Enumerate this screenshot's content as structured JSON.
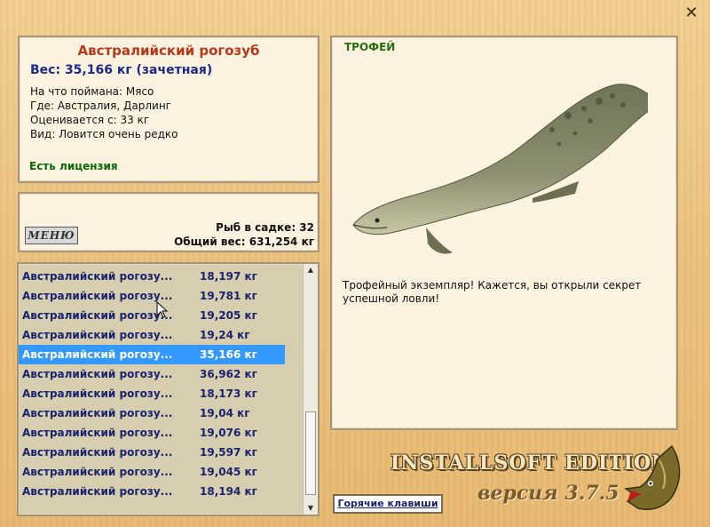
{
  "close_symbol": "✕",
  "info": {
    "title": "Австралийский рогозуб",
    "weight": "Вес: 35,166 кг (зачетная)",
    "caught_on": "На что поймана: Мясо",
    "location": "Где: Австралия, Дарлинг",
    "valued_from": "Оценивается с: 33 кг",
    "rarity": "Вид: Ловится очень редко",
    "license": "Есть лицензия"
  },
  "stats": {
    "menu_logo": "МЕНЮ",
    "fish_in_keepnet": "Рыб в садке: 32",
    "total_weight": "Общий вес: 631,254 кг"
  },
  "catch_list": {
    "rows": [
      {
        "name": "Австралийский рогозу...",
        "weight": "18,197 кг"
      },
      {
        "name": "Австралийский рогозу...",
        "weight": "19,781 кг"
      },
      {
        "name": "Австралийский рогозу...",
        "weight": "19,205 кг"
      },
      {
        "name": "Австралийский рогозу...",
        "weight": "19,24 кг"
      },
      {
        "name": "Австралийский рогозу...",
        "weight": "35,166 кг"
      },
      {
        "name": "Австралийский рогозу...",
        "weight": "36,962 кг"
      },
      {
        "name": "Австралийский рогозу...",
        "weight": "18,173 кг"
      },
      {
        "name": "Австралийский рогозу...",
        "weight": "19,04 кг"
      },
      {
        "name": "Австралийский рогозу...",
        "weight": "19,076 кг"
      },
      {
        "name": "Австралийский рогозу...",
        "weight": "19,597 кг"
      },
      {
        "name": "Австралийский рогозу...",
        "weight": "19,045 кг"
      },
      {
        "name": "Австралийский рогозу...",
        "weight": "18,194 кг"
      }
    ],
    "selected_index": 4
  },
  "trophy": {
    "label": "ТРОФЕЙ",
    "description": "Трофейный экземпляр! Кажется, вы открыли секрет успешной ловли!"
  },
  "hotkeys_label": "Горячие клавиши",
  "edition": "INSTALLSOFT EDITION",
  "version": "версия 3.7.5",
  "colors": {
    "title": "#b23a1a",
    "weight": "#1a2a8a",
    "license": "#0a6a0a",
    "selection": "#3399ff"
  }
}
